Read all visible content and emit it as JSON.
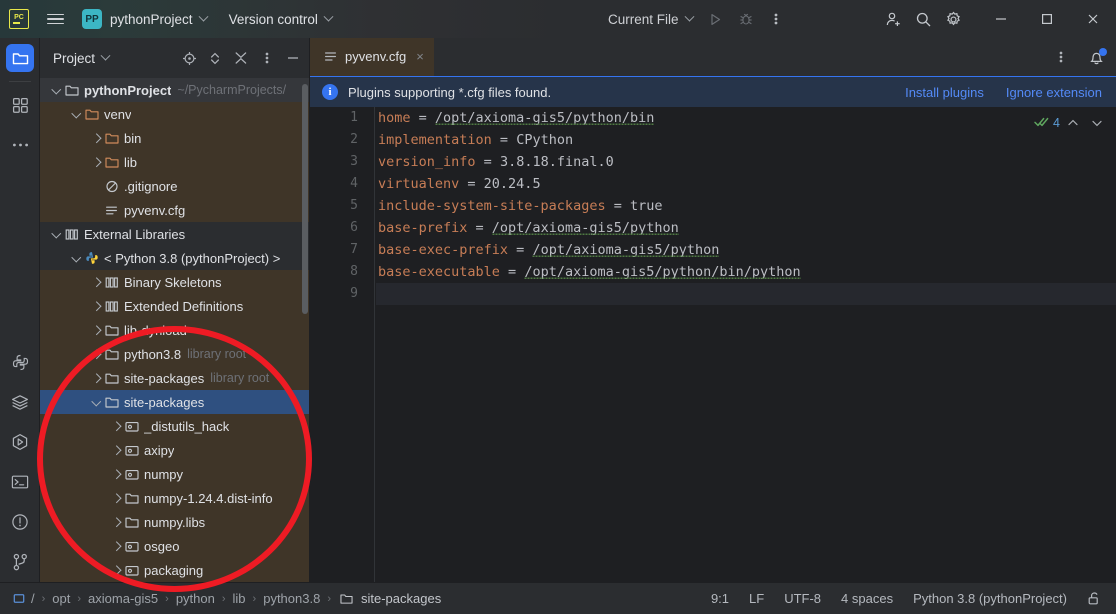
{
  "titlebar": {
    "app_icon": "pycharm-logo-icon",
    "menu_icon": "hamburger-menu-icon",
    "project_badge": "PP",
    "project_name": "pythonProject",
    "version_control": "Version control",
    "run_config": "Current File",
    "run_icon": "run-icon",
    "debug_icon": "debug-icon",
    "more_icon": "more-vertical-icon",
    "account_icon": "add-user-icon",
    "search_icon": "search-icon",
    "settings_icon": "gear-icon",
    "minimize_icon": "minimize-icon",
    "maximize_icon": "maximize-icon",
    "close_icon": "close-icon"
  },
  "activitybar": {
    "top": [
      {
        "name": "project",
        "icon": "folder-icon",
        "active": true
      },
      {
        "name": "structure",
        "icon": "squares-icon",
        "active": false
      },
      {
        "name": "more-tool-windows",
        "icon": "ellipsis-icon",
        "active": false
      }
    ],
    "bottom": [
      {
        "name": "python-console",
        "icon": "python-icon"
      },
      {
        "name": "database",
        "icon": "layers-icon"
      },
      {
        "name": "run",
        "icon": "run-hex-icon"
      },
      {
        "name": "terminal",
        "icon": "terminal-icon"
      },
      {
        "name": "problems",
        "icon": "warning-circle-icon"
      },
      {
        "name": "version-control",
        "icon": "git-branch-icon"
      }
    ]
  },
  "project_panel": {
    "title": "Project",
    "tools": [
      {
        "name": "select-opened-file",
        "icon": "target-icon"
      },
      {
        "name": "expand-collapse",
        "icon": "updown-chevrons-icon"
      },
      {
        "name": "collapse-all",
        "icon": "collapse-all-icon"
      },
      {
        "name": "options",
        "icon": "more-vertical-icon"
      },
      {
        "name": "hide",
        "icon": "minimize-icon"
      }
    ],
    "tree": [
      {
        "indent": 0,
        "arrow": "expanded",
        "icon": "folder-icon",
        "label": "pythonProject",
        "hint": "~/PycharmProjects/",
        "bold": true,
        "state": "focusline"
      },
      {
        "indent": 1,
        "arrow": "expanded",
        "icon": "folder-orange-icon",
        "label": "venv",
        "hint": "",
        "state": "excluded"
      },
      {
        "indent": 2,
        "arrow": "collapsed",
        "icon": "folder-orange-icon",
        "label": "bin",
        "hint": "",
        "state": "excluded"
      },
      {
        "indent": 2,
        "arrow": "collapsed",
        "icon": "folder-orange-icon",
        "label": "lib",
        "hint": "",
        "state": "excluded"
      },
      {
        "indent": 2,
        "arrow": "none",
        "icon": "gitignore-icon",
        "label": ".gitignore",
        "hint": "",
        "state": "excluded"
      },
      {
        "indent": 2,
        "arrow": "none",
        "icon": "cfg-file-icon",
        "label": "pyvenv.cfg",
        "hint": "",
        "state": "excluded"
      },
      {
        "indent": 0,
        "arrow": "expanded",
        "icon": "library-icon",
        "label": "External Libraries",
        "hint": "",
        "state": "normal"
      },
      {
        "indent": 1,
        "arrow": "expanded",
        "icon": "python-icon",
        "label": "< Python 3.8 (pythonProject) >",
        "hint": "",
        "state": "normal"
      },
      {
        "indent": 2,
        "arrow": "collapsed",
        "icon": "library-icon",
        "label": "Binary Skeletons",
        "hint": "",
        "state": "excluded"
      },
      {
        "indent": 2,
        "arrow": "collapsed",
        "icon": "library-icon",
        "label": "Extended Definitions",
        "hint": "",
        "state": "excluded"
      },
      {
        "indent": 2,
        "arrow": "collapsed",
        "icon": "folder-icon",
        "label": "lib-dynload",
        "hint": "",
        "state": "excluded"
      },
      {
        "indent": 2,
        "arrow": "collapsed",
        "icon": "folder-icon",
        "label": "python3.8",
        "hint": "library root",
        "state": "excluded"
      },
      {
        "indent": 2,
        "arrow": "collapsed",
        "icon": "folder-icon",
        "label": "site-packages",
        "hint": "library root",
        "state": "excluded"
      },
      {
        "indent": 2,
        "arrow": "expanded",
        "icon": "folder-icon",
        "label": "site-packages",
        "hint": "",
        "state": "selected"
      },
      {
        "indent": 3,
        "arrow": "collapsed",
        "icon": "package-icon",
        "label": "_distutils_hack",
        "hint": "",
        "state": "excluded"
      },
      {
        "indent": 3,
        "arrow": "collapsed",
        "icon": "package-icon",
        "label": "axipy",
        "hint": "",
        "state": "excluded"
      },
      {
        "indent": 3,
        "arrow": "collapsed",
        "icon": "package-icon",
        "label": "numpy",
        "hint": "",
        "state": "excluded"
      },
      {
        "indent": 3,
        "arrow": "collapsed",
        "icon": "folder-icon",
        "label": "numpy-1.24.4.dist-info",
        "hint": "",
        "state": "excluded"
      },
      {
        "indent": 3,
        "arrow": "collapsed",
        "icon": "folder-icon",
        "label": "numpy.libs",
        "hint": "",
        "state": "excluded"
      },
      {
        "indent": 3,
        "arrow": "collapsed",
        "icon": "package-icon",
        "label": "osgeo",
        "hint": "",
        "state": "excluded"
      },
      {
        "indent": 3,
        "arrow": "collapsed",
        "icon": "package-icon",
        "label": "packaging",
        "hint": "",
        "state": "excluded"
      }
    ]
  },
  "editor": {
    "tab": {
      "label": "pyvenv.cfg",
      "icon": "cfg-file-icon",
      "close": "×"
    },
    "tab_options_icon": "more-vertical-icon",
    "notifications_icon": "bell-icon",
    "banner": {
      "icon": "info-icon",
      "icon_glyph": "i",
      "message": "Plugins supporting *.cfg files found.",
      "install_link": "Install plugins",
      "ignore_link": "Ignore extension"
    },
    "inspection": {
      "icon": "inspection-ok-icon",
      "count": "4",
      "prev_icon": "chevron-up-icon",
      "next_icon": "chevron-down-icon"
    },
    "lines": [
      {
        "n": "1",
        "key": "home",
        "value": "/opt/axioma-gis5/python/bin",
        "squiggle": true
      },
      {
        "n": "2",
        "key": "implementation",
        "value": "CPython",
        "squiggle": false
      },
      {
        "n": "3",
        "key": "version_info",
        "value": "3.8.18.final.0",
        "squiggle": false
      },
      {
        "n": "4",
        "key": "virtualenv",
        "value": "20.24.5",
        "squiggle": false
      },
      {
        "n": "5",
        "key": "include-system-site-packages",
        "value": "true",
        "squiggle": false
      },
      {
        "n": "6",
        "key": "base-prefix",
        "value": "/opt/axioma-gis5/python",
        "squiggle": true
      },
      {
        "n": "7",
        "key": "base-exec-prefix",
        "value": "/opt/axioma-gis5/python",
        "squiggle": true
      },
      {
        "n": "8",
        "key": "base-executable",
        "value": "/opt/axioma-gis5/python/bin/python",
        "squiggle": true
      },
      {
        "n": "9",
        "key": "",
        "value": "",
        "squiggle": false
      }
    ]
  },
  "statusbar": {
    "breadcrumb_icon": "folder-small-icon",
    "breadcrumb": [
      "/",
      "opt",
      "axioma-gis5",
      "python",
      "lib",
      "python3.8",
      "site-packages"
    ],
    "caret": "9:1",
    "line_separator": "LF",
    "encoding": "UTF-8",
    "indent": "4 spaces",
    "interpreter": "Python 3.8 (pythonProject)",
    "lock_icon": "unlocked-icon"
  },
  "annotation": {
    "shape": "red-ellipse-highlight",
    "color": "#ee1b24"
  }
}
